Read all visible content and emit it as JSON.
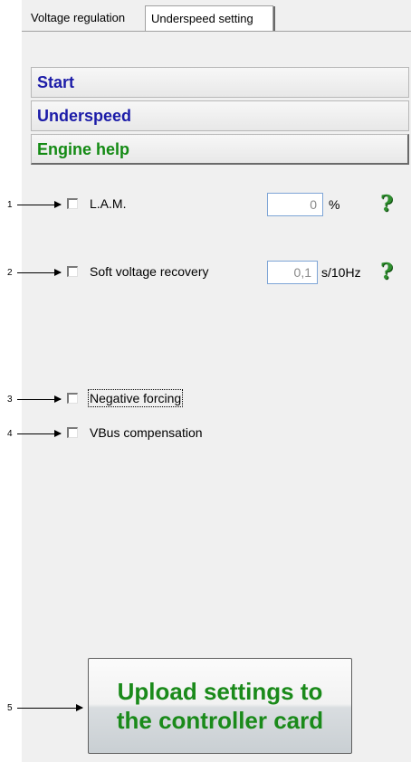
{
  "tabs": [
    {
      "label": "Voltage regulation"
    },
    {
      "label": "Underspeed setting"
    }
  ],
  "sections": {
    "start": "Start",
    "underspeed": "Underspeed",
    "engine_help": "Engine help"
  },
  "annotations": [
    "1",
    "2",
    "3",
    "4",
    "5"
  ],
  "options": {
    "lam": {
      "label": "L.A.M.",
      "checked": false,
      "value": "0",
      "unit": "%"
    },
    "soft_voltage": {
      "label": "Soft voltage recovery",
      "checked": false,
      "value": "0,1",
      "unit": "s/10Hz"
    },
    "negative_forcing": {
      "label": "Negative forcing",
      "checked": false
    },
    "vbus": {
      "label": "VBus compensation",
      "checked": false
    }
  },
  "help_icon_glyph": "?",
  "upload_button": {
    "label": "Upload settings to the controller card"
  },
  "colors": {
    "section_blue": "#1c1ca8",
    "section_green": "#138a13",
    "upload_text": "#1a8a1a",
    "field_border": "#7ea5d6"
  }
}
